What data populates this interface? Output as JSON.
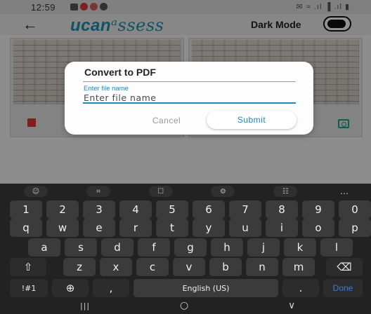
{
  "status_bar": {
    "time": "12:59",
    "right_icons": "✉ ≈ .ıl ▐ .ıl ▮"
  },
  "header": {
    "back": "←",
    "brand_main": "ucan",
    "brand_script": "ᵃssess",
    "dark_mode_label": "Dark Mode"
  },
  "dialog": {
    "title": "Convert to PDF",
    "field_label": "Enter file name",
    "field_placeholder": "Enter file name",
    "field_value": "",
    "cancel_label": "Cancel",
    "submit_label": "Submit"
  },
  "keyboard": {
    "suggestions": [
      "☺",
      "⌗",
      "☐",
      "⚙",
      "☷",
      "…"
    ],
    "row_numbers": [
      "1",
      "2",
      "3",
      "4",
      "5",
      "6",
      "7",
      "8",
      "9",
      "0"
    ],
    "row1": [
      "q",
      "w",
      "e",
      "r",
      "t",
      "y",
      "u",
      "i",
      "o",
      "p"
    ],
    "row2": [
      "a",
      "s",
      "d",
      "f",
      "g",
      "h",
      "j",
      "k",
      "l"
    ],
    "row3": [
      "z",
      "x",
      "c",
      "v",
      "b",
      "n",
      "m"
    ],
    "shift": "⇧",
    "backspace": "⌫",
    "sym": "!#1",
    "globe": "⊕",
    "comma": ",",
    "space": "English (US)",
    "period": ".",
    "done": "Done"
  },
  "navbar": {
    "recents": "|||",
    "home": "○",
    "back": "∨"
  },
  "colors": {
    "accent": "#1e88b8",
    "brand": "#1a8fb0",
    "delete": "#dd3333",
    "camera": "#1aa088",
    "done": "#3a7bd5"
  },
  "icons": {
    "delete": "trash-icon",
    "camera": "camera-icon",
    "back": "back-arrow-icon",
    "toggle": "toggle-switch"
  }
}
